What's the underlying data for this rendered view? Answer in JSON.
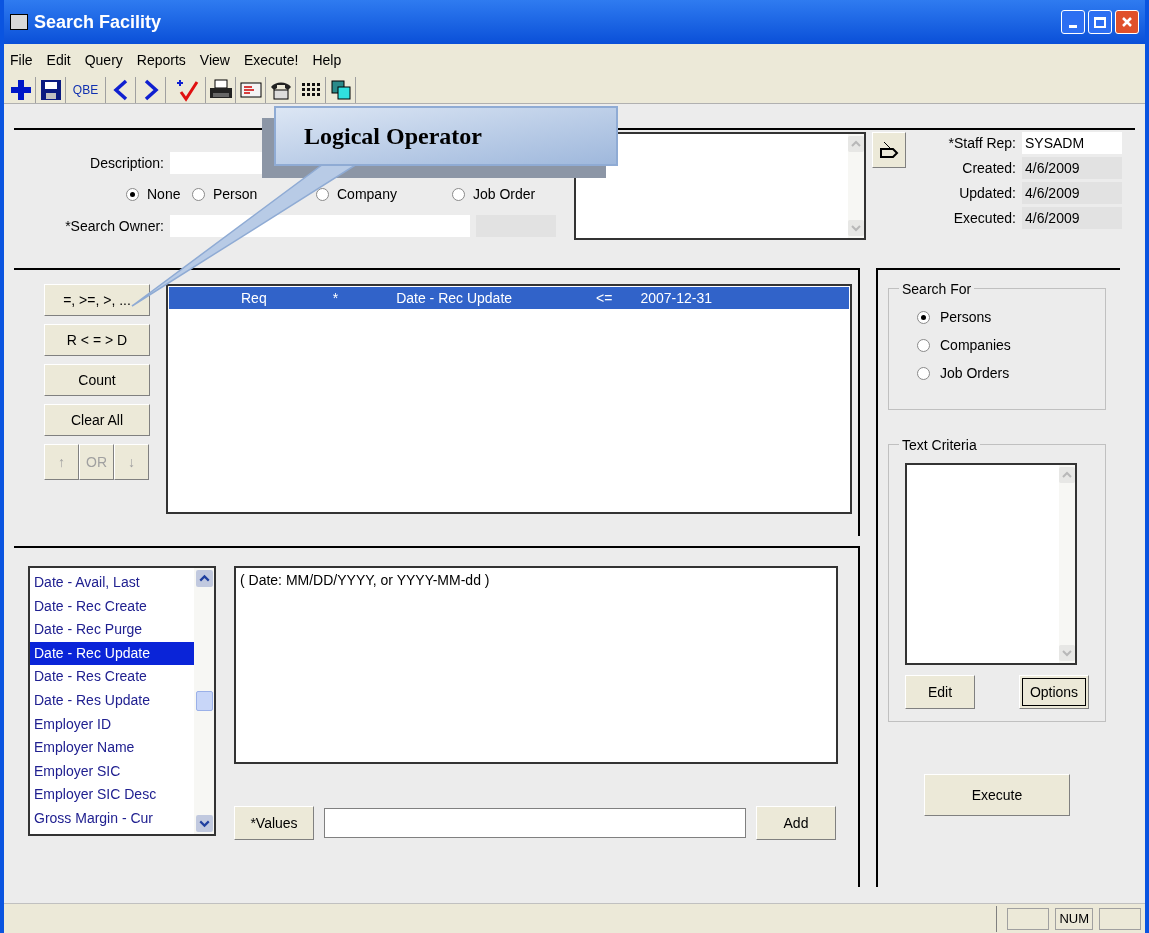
{
  "window": {
    "title": "Search Facility"
  },
  "menu": [
    "File",
    "Edit",
    "Query",
    "Reports",
    "View",
    "Execute!",
    "Help"
  ],
  "toolbar": [
    {
      "kind": "plus"
    },
    {
      "kind": "save"
    },
    {
      "kind": "text",
      "label": "QBE"
    },
    {
      "kind": "left"
    },
    {
      "kind": "right"
    },
    {
      "kind": "check"
    },
    {
      "kind": "print"
    },
    {
      "kind": "fax"
    },
    {
      "kind": "phone"
    },
    {
      "kind": "grid"
    },
    {
      "kind": "windows"
    }
  ],
  "callout": {
    "text": "Logical Operator"
  },
  "header": {
    "description_label": "Description:",
    "link_types": [
      {
        "label": "None",
        "selected": true
      },
      {
        "label": "Person",
        "selected": false
      },
      {
        "label": "Company",
        "selected": false
      },
      {
        "label": "Job Order",
        "selected": false
      }
    ],
    "owner_label": "*Search Owner:",
    "info": [
      {
        "label": "*Staff Rep:",
        "value": "SYSADM",
        "editable": true
      },
      {
        "label": "Created:",
        "value": "4/6/2009",
        "editable": false
      },
      {
        "label": "Updated:",
        "value": "4/6/2009",
        "editable": false
      },
      {
        "label": "Executed:",
        "value": "4/6/2009",
        "editable": false
      }
    ]
  },
  "criteria_buttons": [
    {
      "label": "=, >=, >, ...",
      "disabled": false
    },
    {
      "label": "R < = > D",
      "disabled": false
    },
    {
      "label": "Count",
      "disabled": false
    },
    {
      "label": "Clear All",
      "disabled": false
    }
  ],
  "order_buttons": [
    {
      "label": "↑",
      "disabled": true
    },
    {
      "label": "OR",
      "disabled": true
    },
    {
      "label": "↓",
      "disabled": true
    }
  ],
  "criteria": [
    {
      "cells": [
        "Req",
        "*",
        "Date - Rec Update",
        "<=",
        "2007-12-31"
      ],
      "selected": true
    }
  ],
  "fields": [
    {
      "label": "Date - Avail, Last",
      "selected": false
    },
    {
      "label": "Date - Rec Create",
      "selected": false
    },
    {
      "label": "Date - Rec Purge",
      "selected": false
    },
    {
      "label": "Date - Rec Update",
      "selected": true
    },
    {
      "label": "Date - Res Create",
      "selected": false
    },
    {
      "label": "Date - Res Update",
      "selected": false
    },
    {
      "label": "Employer ID",
      "selected": false
    },
    {
      "label": "Employer Name",
      "selected": false
    },
    {
      "label": "Employer SIC",
      "selected": false
    },
    {
      "label": "Employer SIC Desc",
      "selected": false
    },
    {
      "label": "Gross Margin - Cur",
      "selected": false
    }
  ],
  "hint": "( Date: MM/DD/YYYY, or YYYY-MM-dd )",
  "values_button": "*Values",
  "add_button": "Add",
  "search_for": {
    "title": "Search For",
    "options": [
      {
        "label": "Persons",
        "selected": true
      },
      {
        "label": "Companies",
        "selected": false
      },
      {
        "label": "Job Orders",
        "selected": false
      }
    ]
  },
  "text_criteria": {
    "title": "Text Criteria",
    "buttons": [
      {
        "label": "Edit",
        "focused": false
      },
      {
        "label": "Options",
        "focused": true
      }
    ]
  },
  "execute_button": "Execute",
  "status_bar": {
    "indicator": "NUM"
  }
}
